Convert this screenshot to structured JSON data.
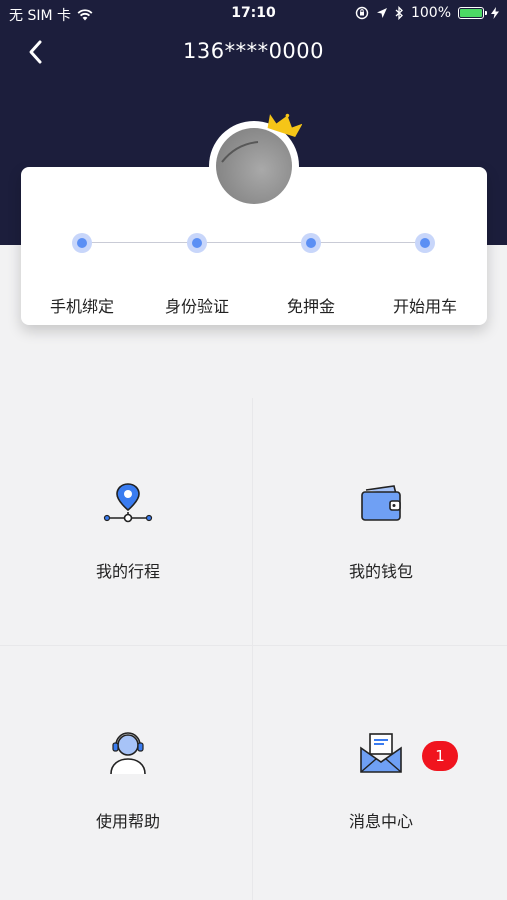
{
  "status_bar": {
    "carrier": "无 SIM 卡",
    "time": "17:10",
    "battery": "100%",
    "battery_level": 1.0
  },
  "nav": {
    "title": "136****0000",
    "back_icon": "chevron-left-icon"
  },
  "profile": {
    "avatar_icon": "avatar",
    "crown_icon": "crown-icon",
    "crown_color": "#f5c518"
  },
  "steps": [
    {
      "label": "手机绑定"
    },
    {
      "label": "身份验证"
    },
    {
      "label": "免押金"
    },
    {
      "label": "开始用车"
    }
  ],
  "menu": [
    {
      "label": "我的行程",
      "icon": "route-pin-icon"
    },
    {
      "label": "我的钱包",
      "icon": "wallet-icon"
    },
    {
      "label": "使用帮助",
      "icon": "support-agent-icon"
    },
    {
      "label": "消息中心",
      "icon": "envelope-icon",
      "badge": "1"
    }
  ],
  "colors": {
    "header": "#1c1e3c",
    "accent": "#5b8ff4",
    "badge": "#f0141e",
    "background": "#f2f2f3"
  }
}
